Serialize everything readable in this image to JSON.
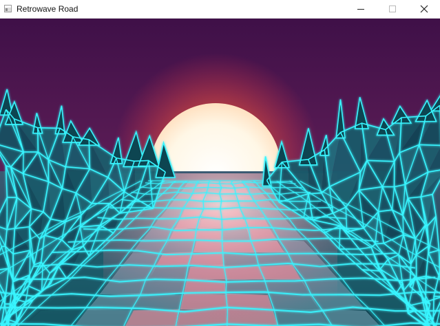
{
  "window": {
    "title": "Retrowave Road",
    "controls": [
      "minimize-icon",
      "maximize-icon",
      "close-icon"
    ]
  },
  "scene": {
    "sky_top": "#43124c",
    "sky_bottom": "#6c2f58",
    "sun_core": "#fff6e2",
    "sun_glow": "#ff5a3a",
    "grid_color": "#38f5ff",
    "terrain_fill": "#0d4551",
    "road_glow": "#ff9fb0"
  }
}
